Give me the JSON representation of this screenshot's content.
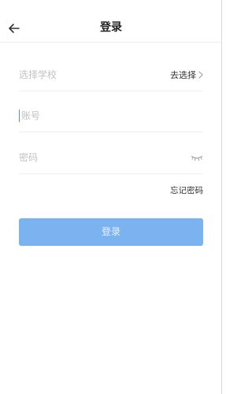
{
  "header": {
    "title": "登录",
    "back_icon": "arrow-left-icon"
  },
  "form": {
    "school": {
      "placeholder": "选择学校",
      "action_label": "去选择",
      "action_icon": "chevron-right-icon"
    },
    "account": {
      "placeholder": "账号"
    },
    "password": {
      "placeholder": "密码",
      "toggle_icon": "eye-closed-icon"
    },
    "forgot_label": "忘记密码",
    "submit_label": "登录"
  },
  "colors": {
    "primary_button": "#7ab3f0",
    "caret": "#4a90e2"
  }
}
